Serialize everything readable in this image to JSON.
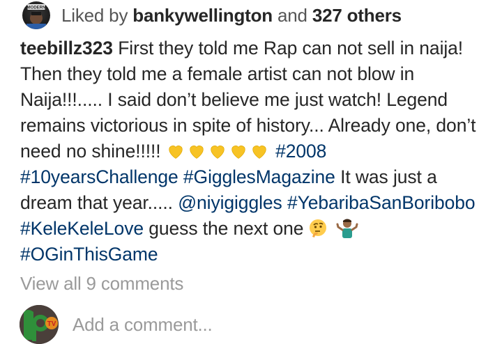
{
  "likes": {
    "prefix": "Liked by",
    "user": "bankywellington",
    "connector": "and",
    "count": "327 others",
    "avatar_badge_text": "MODERN"
  },
  "caption": {
    "username": "teebillz323",
    "text1": "First they told me Rap can not sell in naija! Then they told me a female artist can not blow in Naija!!!..... I said don’t believe me just watch! Legend remains victorious in spite of history... Already one, don’t need no shine!!!!!",
    "hashtags1": [
      "#2008",
      "#10yearsChallenge",
      "#GigglesMagazine"
    ],
    "text2": "It was just a dream that year.....",
    "mention": "@niyigiggles",
    "hashtags2": [
      "#YebaribaSanBoribobo",
      "#KeleKeleLove"
    ],
    "text3": "guess the next one",
    "hashtag_last": "#OGinThisGame",
    "emojis": [
      "yellow-heart",
      "yellow-heart",
      "yellow-heart",
      "yellow-heart",
      "yellow-heart",
      "thinking-face",
      "person-shrugging"
    ]
  },
  "view_comments": "View all 9 comments",
  "comment_input": {
    "placeholder": "Add a comment...",
    "avatar_badge_text": "TV"
  },
  "colors": {
    "text": "#262626",
    "muted": "#9a9a9a",
    "link": "#003569",
    "heart": "#f7c325"
  }
}
